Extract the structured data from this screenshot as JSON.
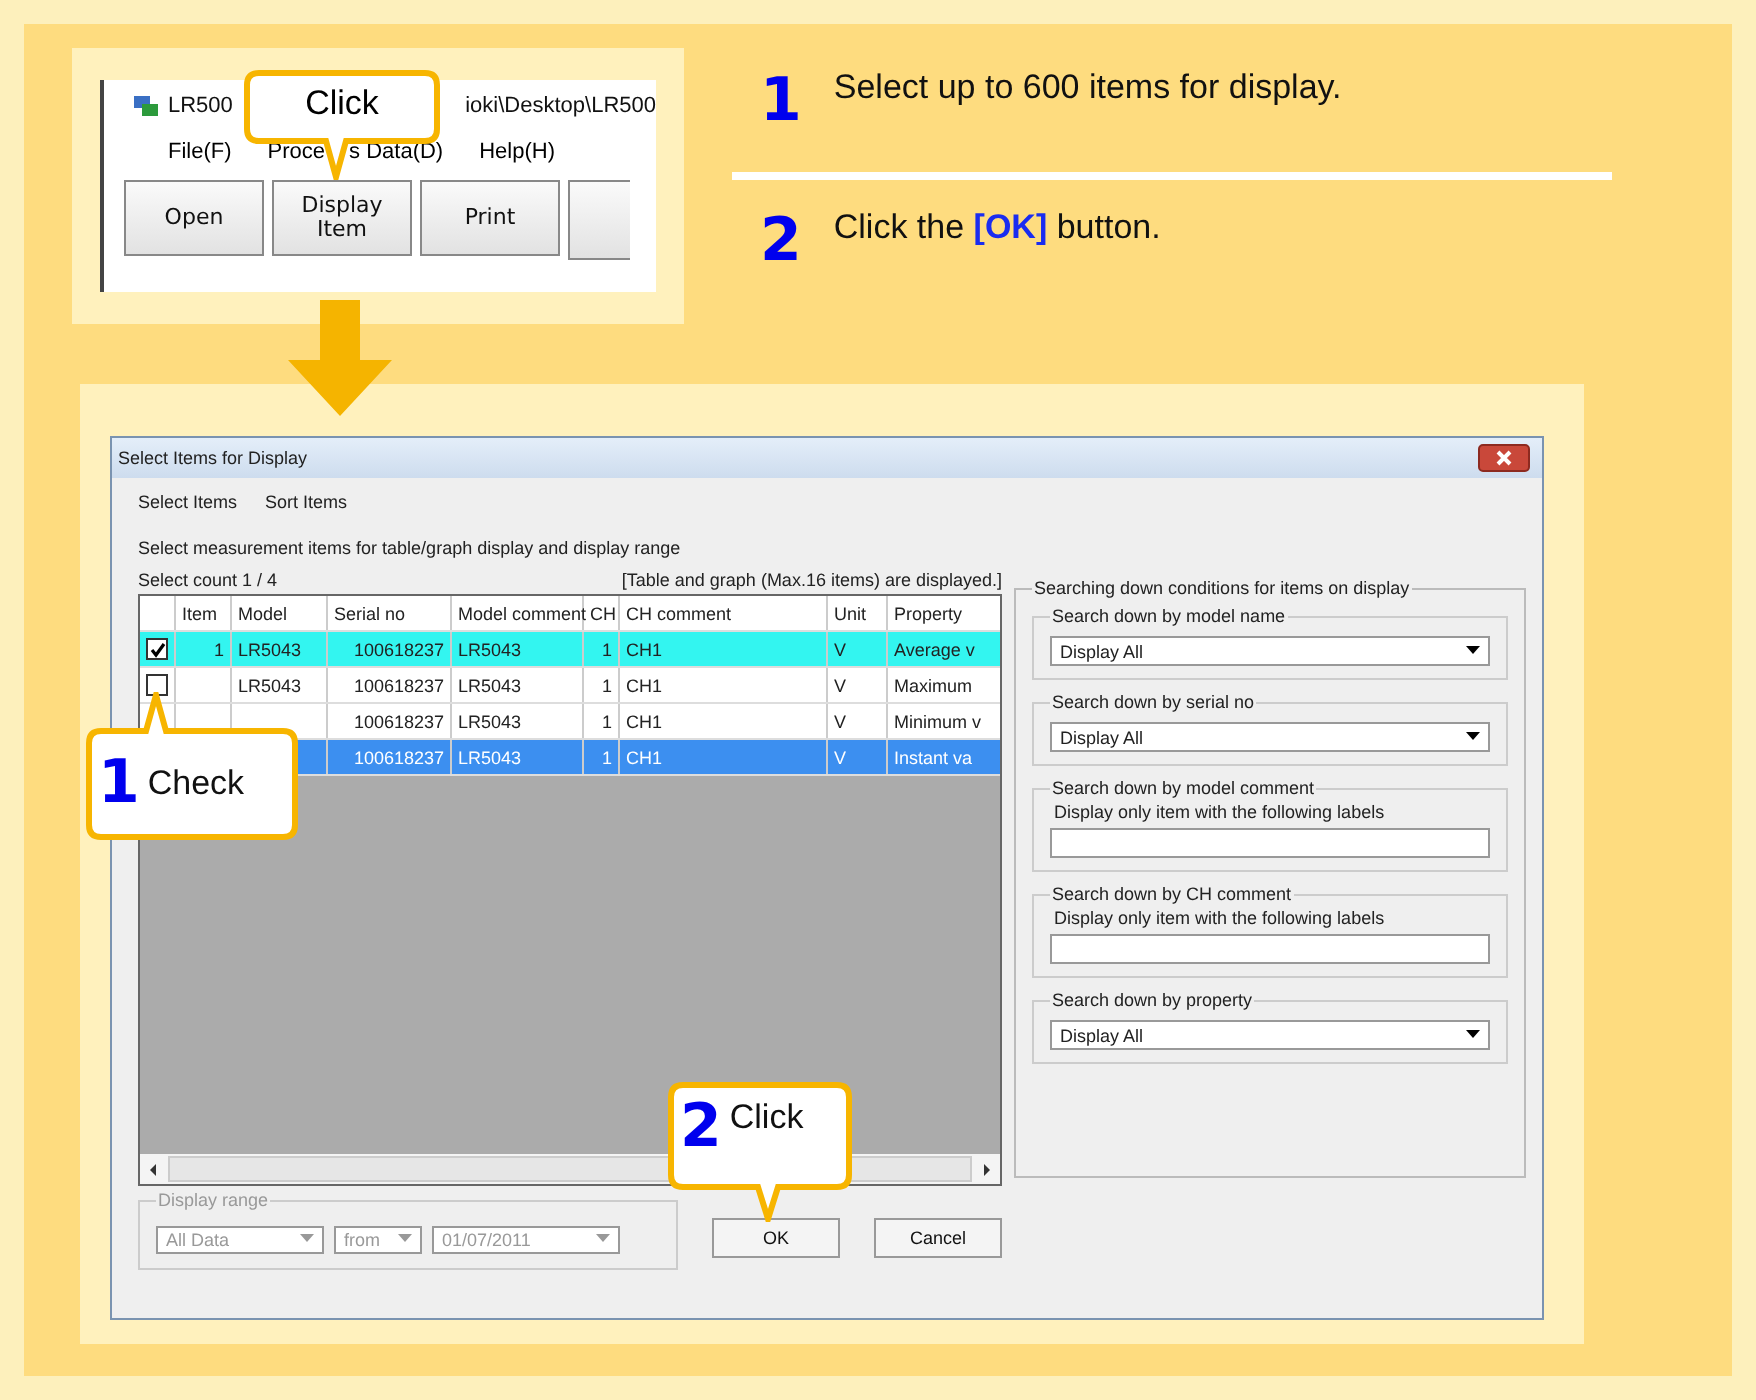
{
  "top_screenshot": {
    "title_parts": [
      "LR500",
      "ioki\\Desktop\\LR500"
    ],
    "menu": [
      [
        "File(F)"
      ],
      [
        "Proce",
        "s Data(D)"
      ],
      [
        "Help(H)"
      ]
    ],
    "toolbar": [
      "Open",
      "Display\nItem",
      "Print"
    ],
    "callout": {
      "text": "Click"
    }
  },
  "steps": [
    {
      "number": "1",
      "text": "Select up to 600 items for display."
    },
    {
      "number": "2",
      "text": "Click the **[OK]** button."
    }
  ],
  "dialog": {
    "title": "Select Items for Display",
    "menu": [
      "Select Items",
      "Sort Items"
    ],
    "instruction": "Select measurement items for table/graph display and display range",
    "count": "Select count 1 / 4",
    "note": "[Table and graph (Max.16 items) are displayed.]",
    "columns": [
      "Item",
      "Model",
      "Serial no",
      "Model comment",
      "CH",
      "CH comment",
      "Unit",
      "Property"
    ],
    "rows": [
      {
        "checked": true,
        "selected": false,
        "item": "1",
        "model": "LR5043",
        "serial": "100618237",
        "model_comment": "LR5043",
        "ch": "1",
        "ch_comment": "CH1",
        "unit": "V",
        "property": "Average v"
      },
      {
        "checked": false,
        "selected": false,
        "model": "LR5043",
        "serial": "100618237",
        "model_comment": "LR5043",
        "ch": "1",
        "ch_comment": "CH1",
        "unit": "V",
        "property": "Maximum"
      },
      {
        "selected": false,
        "serial": "100618237",
        "model_comment": "LR5043",
        "ch": "1",
        "ch_comment": "CH1",
        "unit": "V",
        "property": "Minimum v"
      },
      {
        "selected": true,
        "serial": "100618237",
        "model_comment": "LR5043",
        "ch": "1",
        "ch_comment": "CH1",
        "unit": "V",
        "property": "Instant va"
      }
    ],
    "display_range": {
      "legend": "Display range",
      "disabled": true,
      "combos": [
        "All Data",
        "from",
        "01/07/2011"
      ]
    },
    "buttons": [
      "OK",
      "Cancel"
    ],
    "search": {
      "legend": "Searching down conditions for items on display",
      "groups": [
        {
          "kind": "combo",
          "legend": "Search down by model name",
          "value": "Display All"
        },
        {
          "kind": "combo",
          "legend": "Search down by serial no",
          "value": "Display All"
        },
        {
          "kind": "text",
          "legend": "Search down by model comment",
          "label": "Display only item with the following labels"
        },
        {
          "kind": "text",
          "legend": "Search down by CH comment",
          "label": "Display only item with the following labels"
        },
        {
          "kind": "combo",
          "legend": "Search down by property",
          "value": "Display All"
        }
      ]
    },
    "callouts": [
      {
        "number": "1",
        "text": "Check"
      },
      {
        "number": "2",
        "text": "Click"
      }
    ]
  }
}
